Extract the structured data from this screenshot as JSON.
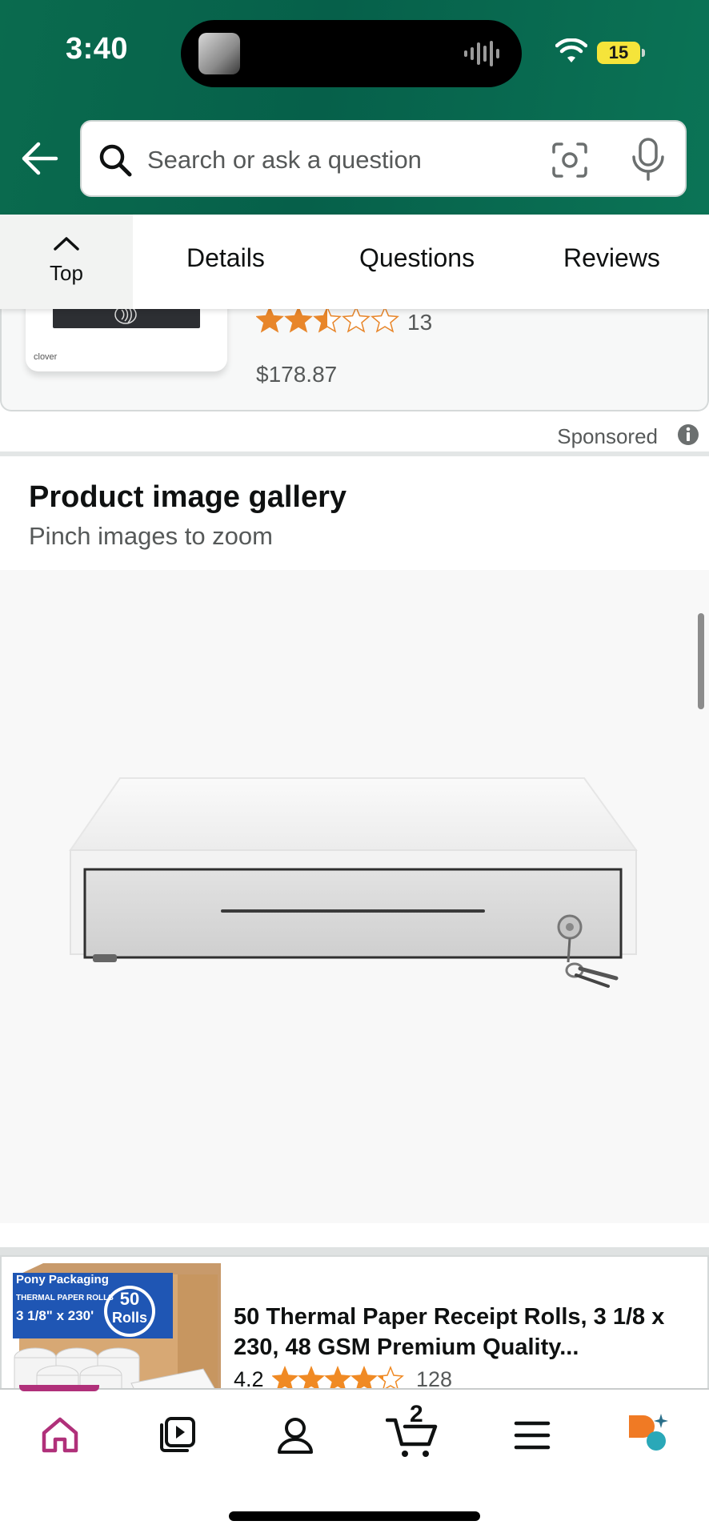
{
  "status_bar": {
    "time": "3:40",
    "battery_level": "15"
  },
  "search": {
    "placeholder": "Search or ask a question"
  },
  "tabs": {
    "top_label": "Top",
    "items": [
      "Details",
      "Questions",
      "Reviews"
    ]
  },
  "previous_product": {
    "rating_count": "13",
    "price": "$178.87",
    "rating": 2.5,
    "brand": "clover"
  },
  "sponsored": {
    "label": "Sponsored"
  },
  "gallery": {
    "title": "Product image gallery",
    "subtitle": "Pinch images to zoom"
  },
  "next_product": {
    "title": "50 Thermal Paper Receipt Rolls, 3 1/8 x 230, 48 GSM Premium Quality...",
    "rating": "4.2",
    "rating_count": "128",
    "box": {
      "brand": "Pony Packaging",
      "line1": "THERMAL PAPER ROLLS",
      "line2": "3 1/8\" x 230'",
      "badge_num": "50",
      "badge_word": "Rolls"
    }
  },
  "bottom_nav": {
    "items": [
      "home-icon",
      "video-icon",
      "account-icon",
      "cart-icon",
      "menu-icon",
      "rufus-icon"
    ],
    "cart_count": "2",
    "active": "home-icon"
  },
  "colors": {
    "header_green": "#06604a",
    "accent_pink": "#b0307a",
    "star_orange": "#f08a24",
    "battery_yellow": "#f5e43a"
  }
}
